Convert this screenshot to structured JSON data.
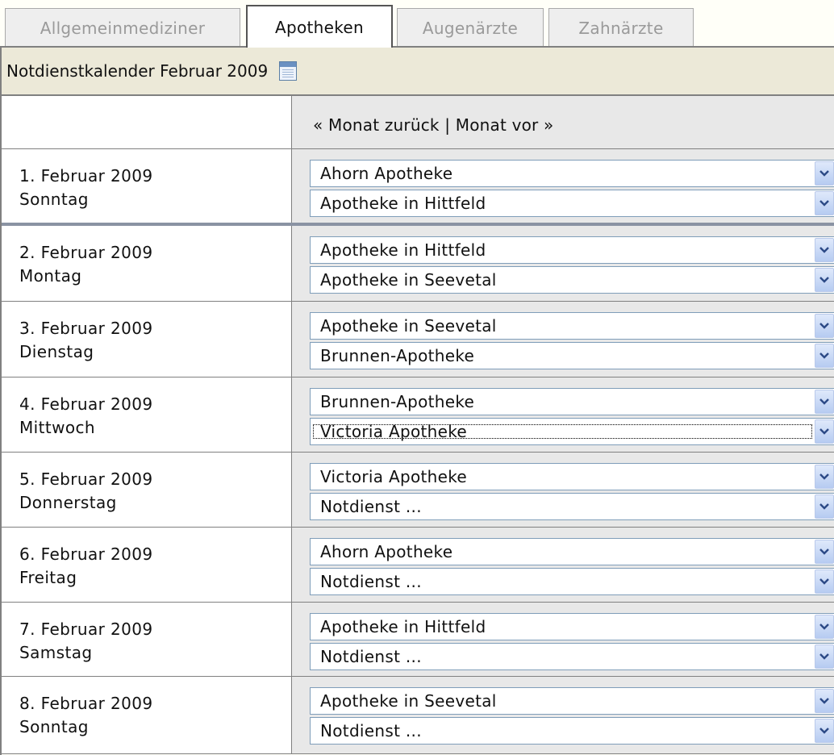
{
  "tabs": [
    {
      "label": "Allgemeinmediziner",
      "active": false
    },
    {
      "label": "Apotheken",
      "active": true
    },
    {
      "label": "Augenärzte",
      "active": false
    },
    {
      "label": "Zahnärzte",
      "active": false
    }
  ],
  "header": {
    "title": "Notdienstkalender Februar 2009",
    "icon": "calendar-icon"
  },
  "navigation": {
    "prev_label": "« Monat zurück",
    "separator": "|",
    "next_label": "Monat vor »"
  },
  "days": [
    {
      "date": "1. Februar 2009",
      "weekday": "Sonntag",
      "slot1": "Ahorn Apotheke",
      "slot2": "Apotheke in Hittfeld"
    },
    {
      "date": "2. Februar 2009",
      "weekday": "Montag",
      "slot1": "Apotheke in Hittfeld",
      "slot2": "Apotheke in Seevetal"
    },
    {
      "date": "3. Februar 2009",
      "weekday": "Dienstag",
      "slot1": "Apotheke in Seevetal",
      "slot2": "Brunnen-Apotheke"
    },
    {
      "date": "4. Februar 2009",
      "weekday": "Mittwoch",
      "slot1": "Brunnen-Apotheke",
      "slot2": "Victoria Apotheke"
    },
    {
      "date": "5. Februar 2009",
      "weekday": "Donnerstag",
      "slot1": "Victoria Apotheke",
      "slot2": "Notdienst ..."
    },
    {
      "date": "6. Februar 2009",
      "weekday": "Freitag",
      "slot1": "Ahorn Apotheke",
      "slot2": "Notdienst ..."
    },
    {
      "date": "7. Februar 2009",
      "weekday": "Samstag",
      "slot1": "Apotheke in Hittfeld",
      "slot2": "Notdienst ..."
    },
    {
      "date": "8. Februar 2009",
      "weekday": "Sonntag",
      "slot1": "Apotheke in Seevetal",
      "slot2": "Notdienst ..."
    }
  ]
}
